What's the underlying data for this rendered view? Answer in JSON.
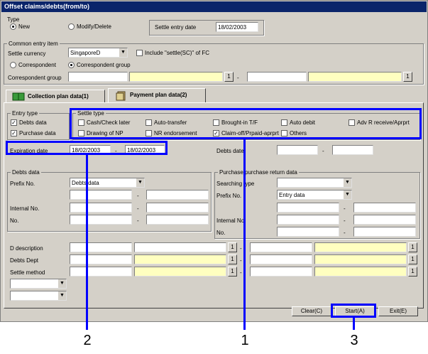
{
  "window": {
    "title": "Offset claims/debts(from/to)",
    "title_color": "#0a246a"
  },
  "type": {
    "title": "Type",
    "new": "New",
    "modify": "Modify/Delete",
    "settle_entry_label": "Settle entry date",
    "settle_entry_value": "18/02/2003"
  },
  "common": {
    "title": "Common entry item",
    "currency_label": "Settle currency",
    "currency_value": "SingaporeD",
    "include_fc": "Include \"settle(SC)\" of FC",
    "correspondent": "Correspondent",
    "correspondent_group": "Correspondent group",
    "group_label": "Correspondent group",
    "btn_1": "1",
    "dash": "-"
  },
  "tabs": {
    "collection": "Collection plan data(1)",
    "payment": "Payment plan data(2)"
  },
  "entry_type": {
    "title": "Entry type",
    "debts": "Debts data",
    "purchase": "Purchase data"
  },
  "settle_type": {
    "title": "Settle type",
    "items": [
      "Cash/Check later",
      "Auto-transfer",
      "Brought-in T/F",
      "Auto debit",
      "Adv R receive/Aprprt",
      "Drawing of NP",
      "NR endorsement",
      "Claim-off/Prpaid-aprprt",
      "Others"
    ]
  },
  "expiration": {
    "label": "Expiration date",
    "from": "18/02/2003",
    "to": "18/02/2003"
  },
  "debts_date": {
    "label": "Debts date"
  },
  "debts_data": {
    "title": "Debts data",
    "prefix_label": "Prefix No.",
    "prefix_value": "Debts data",
    "internal_label": "Internal No.",
    "no_label": "No."
  },
  "purchase_return": {
    "title": "Purchase/purchase return data",
    "search_label": "Searching type",
    "prefix_label": "Prefix No.",
    "prefix_value": "Entry data",
    "internal_label": "Internal No.",
    "no_label": "No."
  },
  "bottom": {
    "d_description": "D description",
    "debts_dept": "Debts Dept",
    "settle_method": "Settle method"
  },
  "buttons": {
    "clear": "Clear(C)",
    "start": "Start(A)",
    "exit": "Exit(E)"
  },
  "callouts": {
    "n1": "1",
    "n2": "2",
    "n3": "3",
    "color": "#0000ff"
  }
}
